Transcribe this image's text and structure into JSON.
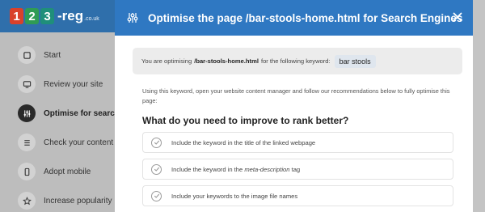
{
  "logo": {
    "digits": [
      "1",
      "2",
      "3"
    ],
    "brand": "-reg",
    "tld": ".co.uk"
  },
  "sidebar": {
    "items": [
      {
        "label": "Start",
        "icon": "square-icon",
        "active": false
      },
      {
        "label": "Review your site",
        "icon": "monitor-icon",
        "active": false
      },
      {
        "label": "Optimise for search",
        "icon": "sliders-icon",
        "active": true
      },
      {
        "label": "Check your content",
        "icon": "list-icon",
        "active": false
      },
      {
        "label": "Adopt mobile",
        "icon": "mobile-icon",
        "active": false
      },
      {
        "label": "Increase popularity",
        "icon": "star-icon",
        "active": false
      }
    ]
  },
  "modal": {
    "title_prefix": "Optimise the page",
    "title_page": "/bar-stools-home.html",
    "title_suffix": "for Search Engines",
    "keyword_box": {
      "prefix": "You are optimising",
      "filename": "/bar-stools-home.html",
      "suffix": "for the following keyword:",
      "keyword": "bar stools"
    },
    "instructions": "Using this keyword, open your website content manager and follow our recommendations below to fully optimise this page:",
    "section_heading": "What do you need to improve to rank better?",
    "checklist": [
      {
        "before": "Include the keyword in the title of the linked webpage",
        "em": "",
        "after": ""
      },
      {
        "before": "Include the keyword in the ",
        "em": "meta-description",
        "after": " tag"
      },
      {
        "before": "Include your keywords to the image file names",
        "em": "",
        "after": ""
      }
    ]
  },
  "colors": {
    "header_blue": "#2f78c2",
    "logo_blue": "#2f6fab",
    "active_circle": "#2a2a2a",
    "keyword_box_bg": "#ececec"
  }
}
